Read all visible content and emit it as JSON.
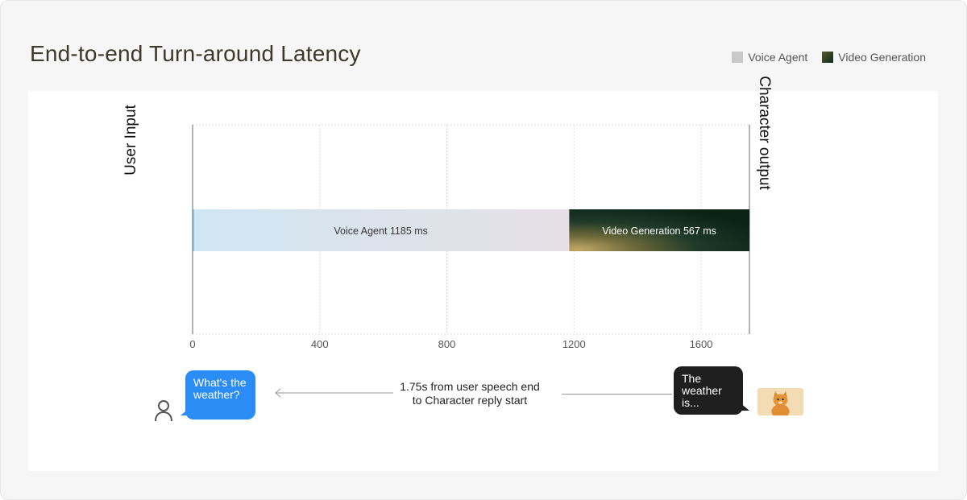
{
  "title": "End-to-end Turn-around Latency",
  "legend": [
    {
      "label": "Voice Agent",
      "color": "#c9c9c9"
    },
    {
      "label": "Video Generation",
      "color": "#0c2a1c"
    }
  ],
  "axis_labels": {
    "left": "User Input",
    "right": "Character output"
  },
  "chart_data": {
    "type": "bar",
    "orientation": "horizontal",
    "stacked": true,
    "title": "End-to-end Turn-around Latency",
    "xlim": [
      0,
      1752
    ],
    "xticks": [
      0,
      400,
      800,
      1200,
      1600
    ],
    "grid": true,
    "legend_position": "top-right",
    "series": [
      {
        "name": "Voice Agent",
        "value": 1185,
        "label": "Voice Agent 1185 ms",
        "color": "#c9c9c9"
      },
      {
        "name": "Video Generation",
        "value": 567,
        "label": "Video Generation 567 ms",
        "color": "#0c2a1c"
      }
    ]
  },
  "conversation": {
    "user_message": "What's the weather?",
    "character_message": "The weather is...",
    "latency_note_line1": "1.75s from user speech end",
    "latency_note_line2": "to Character reply start"
  },
  "icons": {
    "user": "user-icon",
    "character": "cat-avatar"
  }
}
